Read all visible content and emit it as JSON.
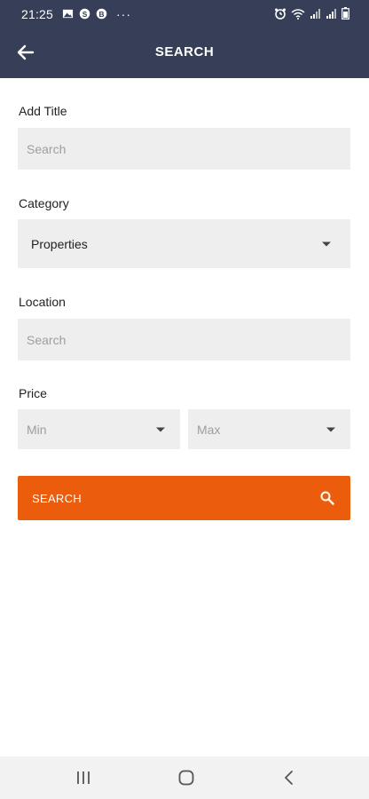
{
  "status_bar": {
    "time": "21:25",
    "left_icons": [
      "gallery-icon",
      "skype-icon",
      "b-icon"
    ],
    "dots": "···",
    "right_icons": [
      "alarm-icon",
      "wifi-icon",
      "signal-icon",
      "signal-icon",
      "battery-icon"
    ]
  },
  "header": {
    "title": "SEARCH",
    "back_icon": "arrow-left-icon"
  },
  "form": {
    "title_label": "Add Title",
    "title_placeholder": "Search",
    "category_label": "Category",
    "category_value": "Properties",
    "location_label": "Location",
    "location_placeholder": "Search",
    "price_label": "Price",
    "price_min": "Min",
    "price_max": "Max"
  },
  "search_button": {
    "label": "SEARCH",
    "icon": "search-icon"
  },
  "colors": {
    "header_bg": "#373e57",
    "accent": "#eb5c0c",
    "field_bg": "#eeeeee"
  },
  "nav_bar": {
    "icons": [
      "recent-apps-icon",
      "home-icon",
      "back-icon"
    ]
  }
}
